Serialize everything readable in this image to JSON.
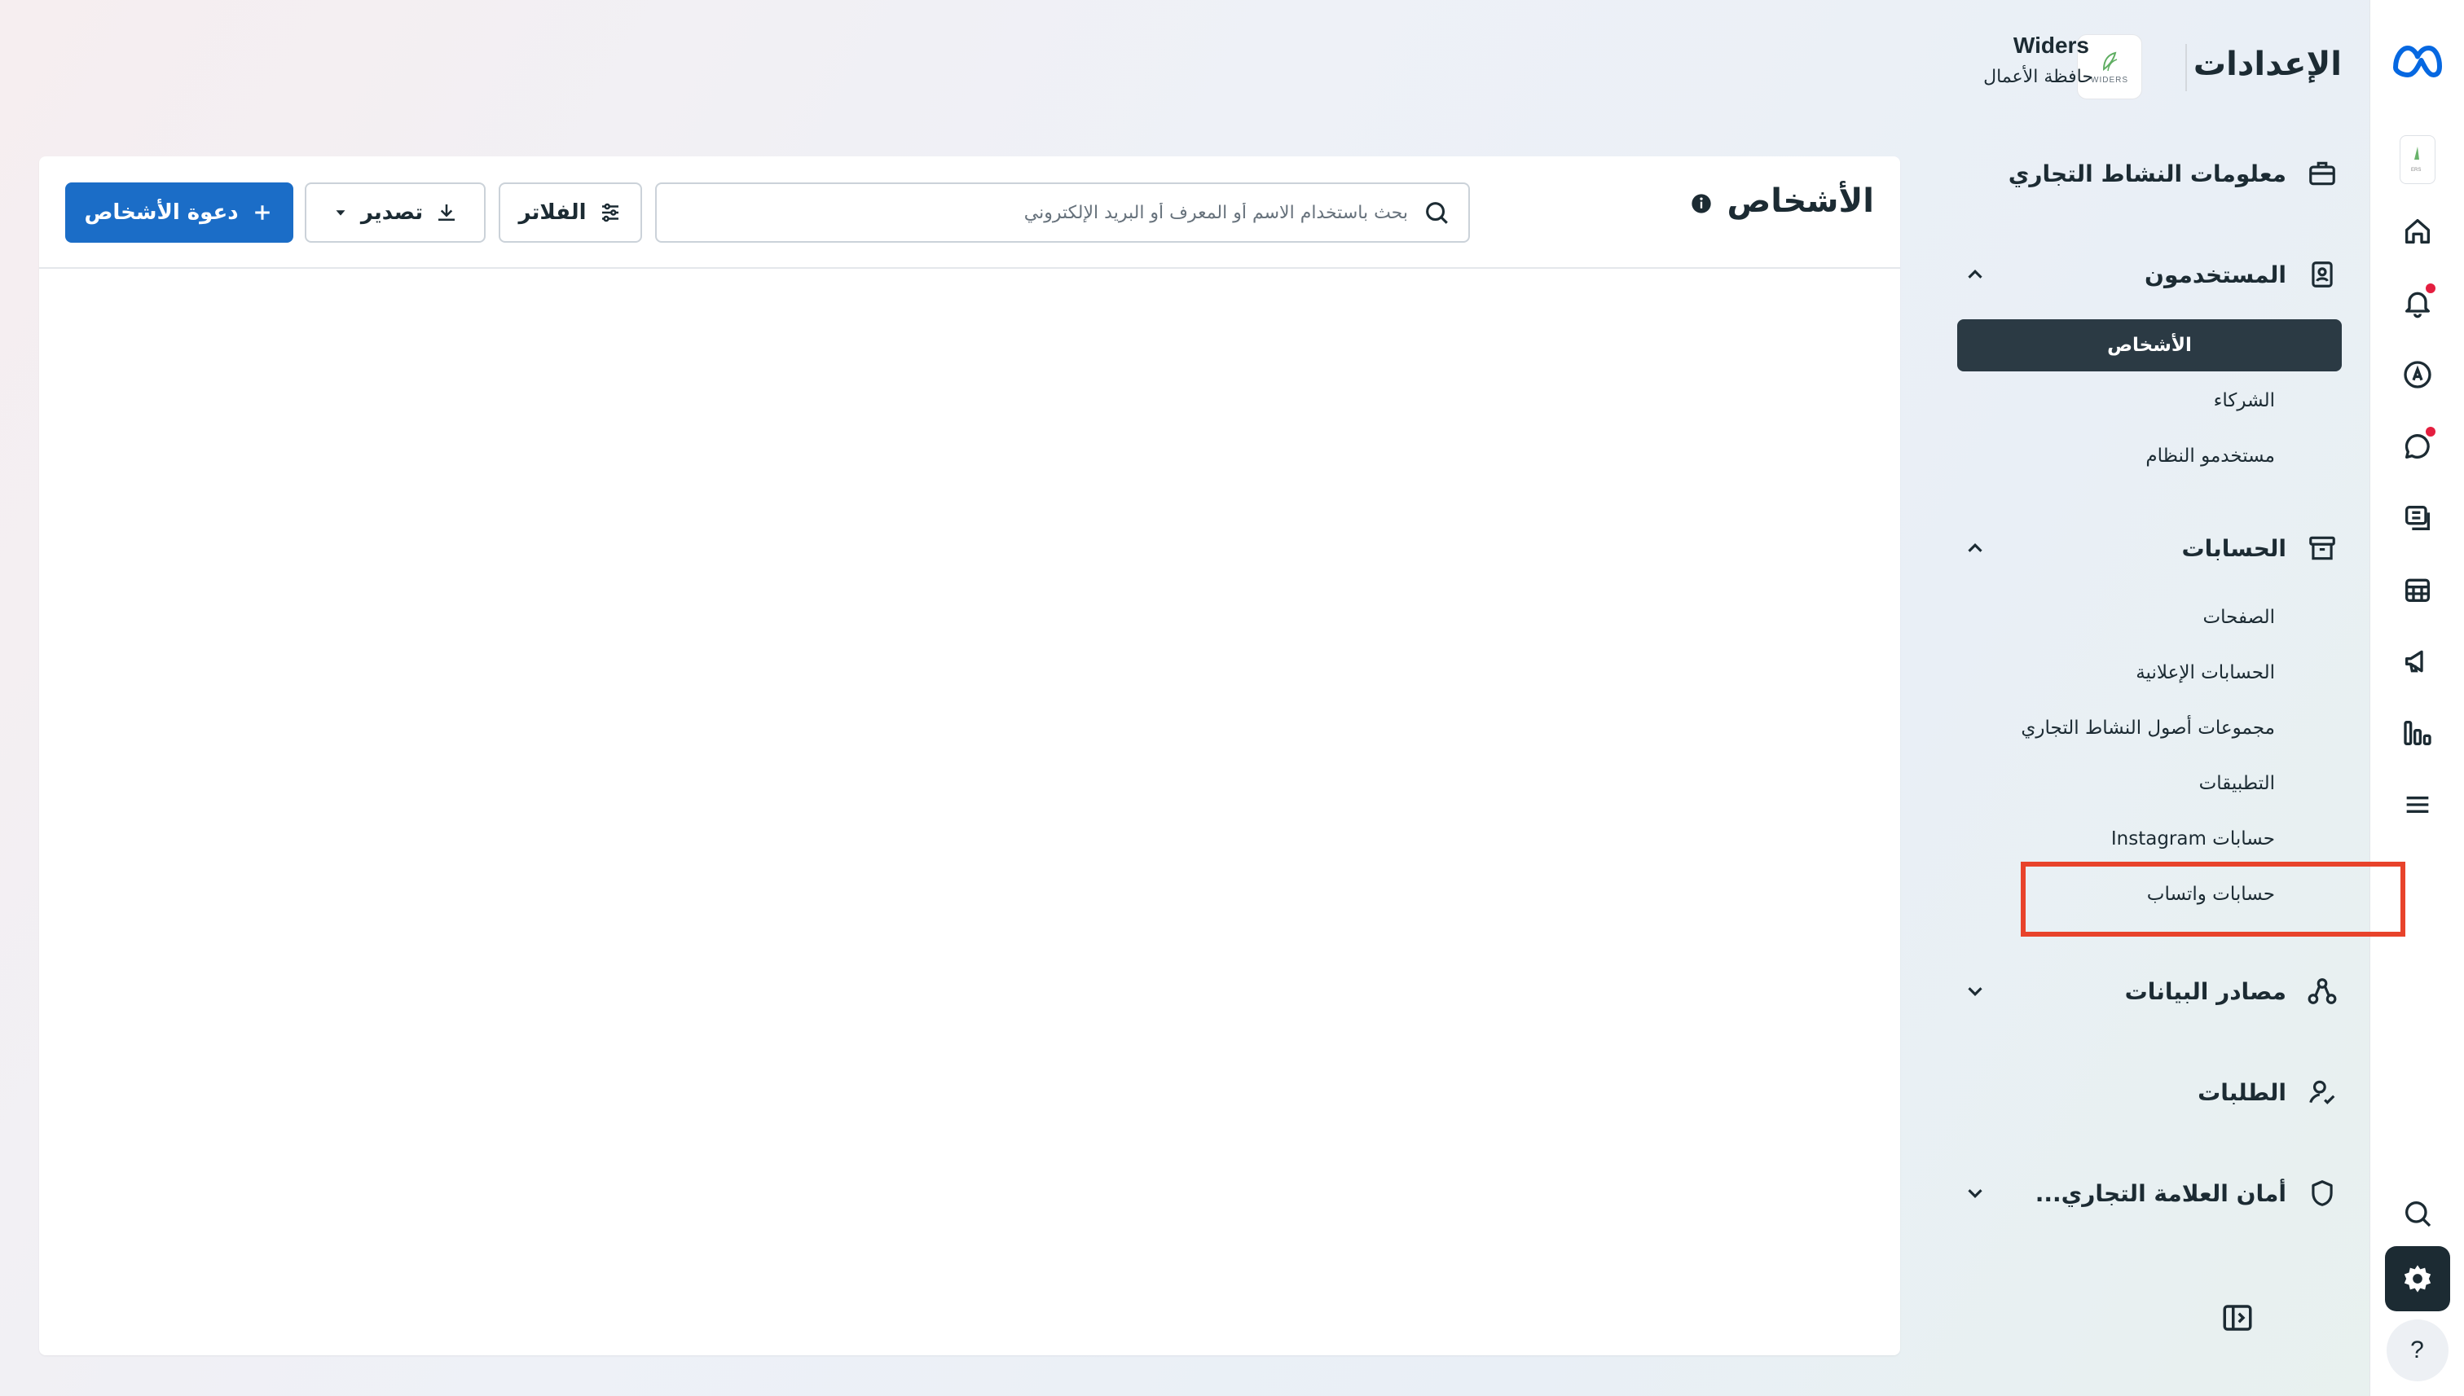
{
  "rail": {
    "items": [
      {
        "name": "meta-logo-icon"
      },
      {
        "name": "business-thumbnail-icon"
      },
      {
        "name": "home-icon"
      },
      {
        "name": "notifications-icon"
      },
      {
        "name": "ads-manager-icon"
      },
      {
        "name": "inbox-icon"
      },
      {
        "name": "content-icon"
      },
      {
        "name": "planner-icon"
      },
      {
        "name": "ads-icon"
      },
      {
        "name": "insights-icon"
      },
      {
        "name": "menu-icon"
      },
      {
        "name": "search-icon"
      },
      {
        "name": "settings-gear-icon"
      }
    ],
    "help_label": "?"
  },
  "header": {
    "title": "الإعدادات",
    "business_name": "Widers",
    "business_subtitle": "حافظة الأعمال",
    "logo_text": "WIDERS"
  },
  "nav": {
    "business_info": "معلومات النشاط التجاري",
    "users": {
      "label": "المستخدمون",
      "items": [
        "الأشخاص",
        "الشركاء",
        "مستخدمو النظام"
      ]
    },
    "accounts": {
      "label": "الحسابات",
      "items": [
        "الصفحات",
        "الحسابات الإعلانية",
        "مجموعات أصول النشاط التجاري",
        "التطبيقات",
        "حسابات Instagram",
        "حسابات واتساب"
      ]
    },
    "data_sources": "مصادر البيانات",
    "requests": "الطلبات",
    "brand_safety": "أمان العلامة التجاري..."
  },
  "main": {
    "title": "الأشخاص",
    "search_placeholder": "بحث باستخدام الاسم أو المعرف أو البريد الإلكتروني",
    "filters_label": "الفلاتر",
    "export_label": "تصدير",
    "invite_label": "دعوة الأشخاص"
  },
  "colors": {
    "primary": "#1b6dc7",
    "active_nav": "#2b3a44",
    "highlight": "#e8432b",
    "notification_dot": "#e41e3f"
  }
}
